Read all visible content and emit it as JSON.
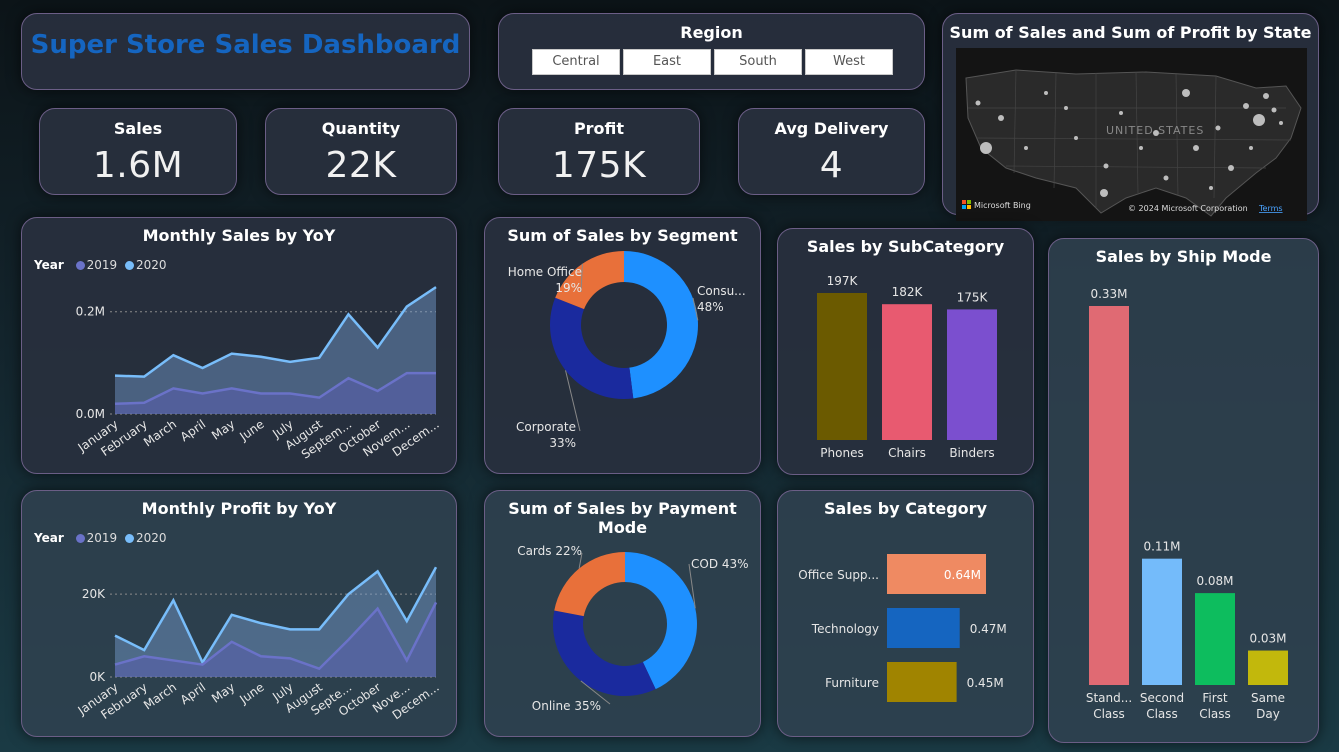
{
  "title": "Super Store Sales Dashboard",
  "region": {
    "label": "Region",
    "options": [
      "Central",
      "East",
      "South",
      "West"
    ]
  },
  "kpis": {
    "sales": {
      "label": "Sales",
      "value": "1.6M"
    },
    "quantity": {
      "label": "Quantity",
      "value": "22K"
    },
    "profit": {
      "label": "Profit",
      "value": "175K"
    },
    "delivery": {
      "label": "Avg Delivery",
      "value": "4"
    }
  },
  "map": {
    "title": "Sum of Sales and Sum of Profit by State",
    "country_label": "UNITED STATES",
    "bing": "Microsoft Bing",
    "copyright": "© 2024 Microsoft Corporation",
    "terms": "Terms"
  },
  "legend_prefix": "Year",
  "colors": {
    "y2019": "#6a72c8",
    "y2020": "#78bdfa"
  },
  "chart_data": [
    {
      "id": "sales_yoy",
      "type": "area",
      "title": "Monthly Sales by YoY",
      "categories": [
        "January",
        "February",
        "March",
        "April",
        "May",
        "June",
        "July",
        "August",
        "September",
        "October",
        "November",
        "December"
      ],
      "tick_labels": [
        "January",
        "February",
        "March",
        "April",
        "May",
        "June",
        "July",
        "August",
        "Septem...",
        "October",
        "Novem...",
        "Decem..."
      ],
      "series": [
        {
          "name": "2019",
          "values": [
            0.02,
            0.022,
            0.05,
            0.04,
            0.05,
            0.04,
            0.04,
            0.032,
            0.07,
            0.045,
            0.08,
            0.08
          ]
        },
        {
          "name": "2020",
          "values": [
            0.075,
            0.073,
            0.115,
            0.09,
            0.118,
            0.112,
            0.102,
            0.11,
            0.195,
            0.13,
            0.21,
            0.248
          ]
        }
      ],
      "ylim": [
        0,
        0.26
      ],
      "yticks": [
        {
          "value": 0,
          "label": "0.0M"
        },
        {
          "value": 0.2,
          "label": "0.2M"
        }
      ],
      "grid": true
    },
    {
      "id": "profit_yoy",
      "type": "area",
      "title": "Monthly Profit by YoY",
      "categories": [
        "January",
        "February",
        "March",
        "April",
        "May",
        "June",
        "July",
        "August",
        "September",
        "October",
        "November",
        "December"
      ],
      "tick_labels": [
        "January",
        "February",
        "March",
        "April",
        "May",
        "June",
        "July",
        "August",
        "Septe...",
        "October",
        "Nove...",
        "Decem..."
      ],
      "series": [
        {
          "name": "2019",
          "values": [
            3000,
            5000,
            4000,
            3000,
            8500,
            5000,
            4500,
            2000,
            9000,
            16500,
            4000,
            18000
          ]
        },
        {
          "name": "2020",
          "values": [
            10000,
            6500,
            18500,
            3500,
            15000,
            13000,
            11500,
            11500,
            20000,
            25500,
            13500,
            26500
          ]
        }
      ],
      "ylim": [
        0,
        28000
      ],
      "yticks": [
        {
          "value": 0,
          "label": "0K"
        },
        {
          "value": 20000,
          "label": "20K"
        }
      ],
      "grid": true
    },
    {
      "id": "segment",
      "type": "pie",
      "title": "Sum of Sales by Segment",
      "slices": [
        {
          "name": "Consu...",
          "pct": "48%",
          "value": 48,
          "color": "#1e90ff"
        },
        {
          "name": "Corporate",
          "pct": "33%",
          "value": 33,
          "color": "#1a2a9e"
        },
        {
          "name": "Home Office",
          "pct": "19%",
          "value": 19,
          "color": "#e8703a"
        }
      ]
    },
    {
      "id": "payment",
      "type": "pie",
      "title": "Sum of Sales by Payment Mode",
      "slices": [
        {
          "name": "COD",
          "pct": "43%",
          "value": 43,
          "color": "#1e90ff"
        },
        {
          "name": "Online",
          "pct": "35%",
          "value": 35,
          "color": "#1a2a9e"
        },
        {
          "name": "Cards",
          "pct": "22%",
          "value": 22,
          "color": "#e8703a"
        }
      ]
    },
    {
      "id": "subcategory",
      "type": "bar",
      "title": "Sales by SubCategory",
      "categories": [
        "Phones",
        "Chairs",
        "Binders"
      ],
      "values": [
        197,
        182,
        175
      ],
      "labels": [
        "197K",
        "182K",
        "175K"
      ],
      "colors": [
        "#6b5a00",
        "#e85a70",
        "#7b4fcf"
      ],
      "ylim": [
        0,
        197
      ]
    },
    {
      "id": "category",
      "type": "bar",
      "orientation": "horizontal",
      "title": "Sales by Category",
      "categories": [
        "Office Supp...",
        "Technology",
        "Furniture"
      ],
      "values": [
        0.64,
        0.47,
        0.45
      ],
      "labels": [
        "0.64M",
        "0.47M",
        "0.45M"
      ],
      "colors": [
        "#ef8a62",
        "#1565c0",
        "#a08400"
      ],
      "xlim": [
        0,
        0.64
      ]
    },
    {
      "id": "shipmode",
      "type": "bar",
      "title": "Sales by Ship Mode",
      "categories": [
        "Stand... Class",
        "Second Class",
        "First Class",
        "Same Day"
      ],
      "values": [
        0.33,
        0.11,
        0.08,
        0.03
      ],
      "labels": [
        "0.33M",
        "0.11M",
        "0.08M",
        "0.03M"
      ],
      "colors": [
        "#e06a73",
        "#74bbfa",
        "#0dbd5e",
        "#c2b80c"
      ],
      "ylim": [
        0,
        0.33
      ]
    }
  ]
}
